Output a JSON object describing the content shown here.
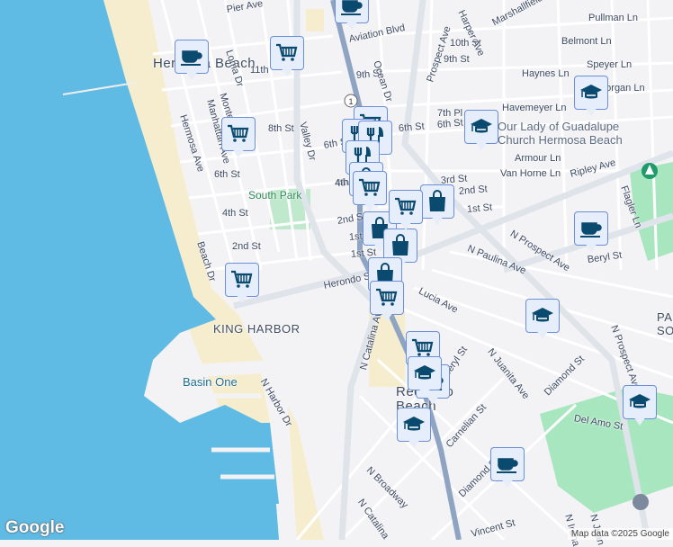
{
  "map": {
    "areas": [
      {
        "label": "Hermosa Beach"
      },
      {
        "label": "KING HARBOR"
      },
      {
        "label": "Redondo Beach"
      },
      {
        "label": "PA SOU"
      }
    ],
    "water": [
      {
        "label": "Basin One"
      }
    ],
    "parks": [
      {
        "label": "South Park"
      }
    ],
    "poi": [
      {
        "label": "Our Lady of Guadalupe"
      },
      {
        "label": "Church Hermosa Beach"
      }
    ],
    "highway_shield": "1",
    "streets": [
      "Pier Ave",
      "Aviation Blvd",
      "10th St",
      "9th St",
      "9th St",
      "Ocean Dr",
      "Prospect Ave",
      "Harper Ave",
      "Marshallfield",
      "Pullman Ln",
      "Belmont Ln",
      "Speyer Ln",
      "Haynes Ln",
      "Morgan Ln",
      "Havemeyer Ln",
      "7th Pl",
      "6th St",
      "6th St",
      "Armour Ln",
      "Van Horne Ln",
      "Ripley Ave",
      "Flagler Ln",
      "3rd St",
      "2nd St",
      "1st St",
      "4th St",
      "2nd St",
      "1st St",
      "1st St",
      "Herondo St",
      "N Paulina Ave",
      "N Prospect Ave",
      "Beryl St",
      "Lucia Ave",
      "N Catalina Ave",
      "Beryl St",
      "N Juanita Ave",
      "Diamond St",
      "Del Amo St",
      "Carnelian St",
      "Diamond St",
      "N Broadway",
      "N Catalina",
      "Vincent St",
      "N Prospect Ave",
      "Hermosa Ave",
      "Manhattan Ave",
      "Loma Dr",
      "Monterey",
      "11th",
      "8th St",
      "6th St",
      "4th St",
      "2nd St",
      "Beach Dr",
      "Valley Dr",
      "N Harbor Dr",
      "N Irena",
      "N Juan",
      "6th St",
      "4th St"
    ],
    "markers": [
      {
        "type": "coffee-icon"
      },
      {
        "type": "coffee-icon"
      },
      {
        "type": "cart-icon"
      },
      {
        "type": "cart-icon"
      },
      {
        "type": "school-icon"
      },
      {
        "type": "school-icon"
      },
      {
        "type": "cart-icon"
      },
      {
        "type": "restaurant-icon"
      },
      {
        "type": "restaurant-icon"
      },
      {
        "type": "restaurant-icon"
      },
      {
        "type": "shopping-bag-icon"
      },
      {
        "type": "cart-icon"
      },
      {
        "type": "shopping-bag-icon"
      },
      {
        "type": "shopping-bag-icon"
      },
      {
        "type": "shopping-bag-icon"
      },
      {
        "type": "coffee-icon"
      },
      {
        "type": "cart-icon"
      },
      {
        "type": "shopping-bag-icon"
      },
      {
        "type": "cart-icon"
      },
      {
        "type": "school-icon"
      },
      {
        "type": "cart-icon"
      },
      {
        "type": "cart-icon"
      },
      {
        "type": "school-icon"
      },
      {
        "type": "coffee-icon"
      },
      {
        "type": "coffee-icon"
      },
      {
        "type": "school-icon"
      },
      {
        "type": "school-icon"
      }
    ],
    "attribution": "Map data ©2025 Google",
    "logo": "Google"
  },
  "colors": {
    "ocean": "#5fbbe4",
    "land": "#f3f2f4",
    "park": "#a8e6bf",
    "sand": "#f6edcf",
    "marker_fill": "#e6edfb",
    "marker_border": "#6b8fd6",
    "icon": "#0b4a6f"
  }
}
